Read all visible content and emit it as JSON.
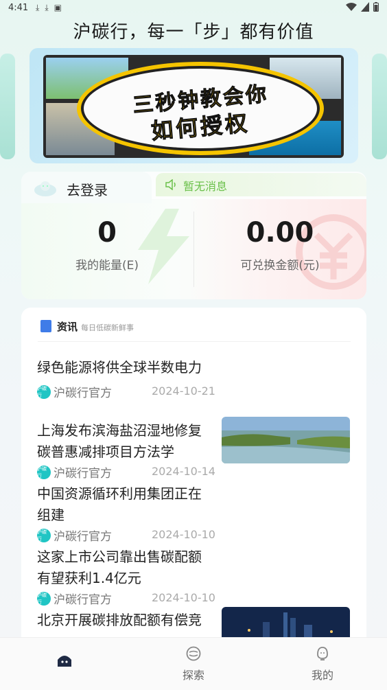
{
  "status_bar": {
    "time": "4:41"
  },
  "header": {
    "title": "沪碳行，每一「步」都有价值"
  },
  "banner": {
    "line1": "三秒钟教会你",
    "line2": "如何授权"
  },
  "energy_card": {
    "login_label": "去登录",
    "notice": "暂无消息",
    "energy_value": "0",
    "energy_label": "我的能量(E)",
    "amount_value": "0.00",
    "amount_label": "可兑换金额(元)"
  },
  "news": {
    "header_title": "资讯",
    "header_subtitle": "每日低碳新鲜事",
    "source_logo_text": "沪碳行",
    "items": [
      {
        "title_lines": [
          "绿色能源将供全球半数电力"
        ],
        "source": "沪碳行官方",
        "date": "2024-10-21",
        "has_image": false
      },
      {
        "title_lines": [
          "上海发布滨海盐沼湿地修复",
          "碳普惠减排项目方法学"
        ],
        "source": "沪碳行官方",
        "date": "2024-10-14",
        "has_image": true
      },
      {
        "title_lines": [
          "中国资源循环利用集团正在",
          "组建"
        ],
        "source": "沪碳行官方",
        "date": "2024-10-10",
        "has_image": false
      },
      {
        "title_lines": [
          "这家上市公司靠出售碳配额",
          "有望获利1.4亿元"
        ],
        "source": "沪碳行官方",
        "date": "2024-10-10",
        "has_image": false
      },
      {
        "title_lines": [
          "北京开展碳排放配额有偿竞"
        ],
        "source": "",
        "date": "",
        "has_image": true
      }
    ]
  },
  "bottom_nav": {
    "explore": "探索",
    "mine": "我的"
  },
  "colors": {
    "accent_green": "#6ac04a",
    "logo_teal": "#20c5c4",
    "news_icon_blue": "#3f7ce8"
  }
}
